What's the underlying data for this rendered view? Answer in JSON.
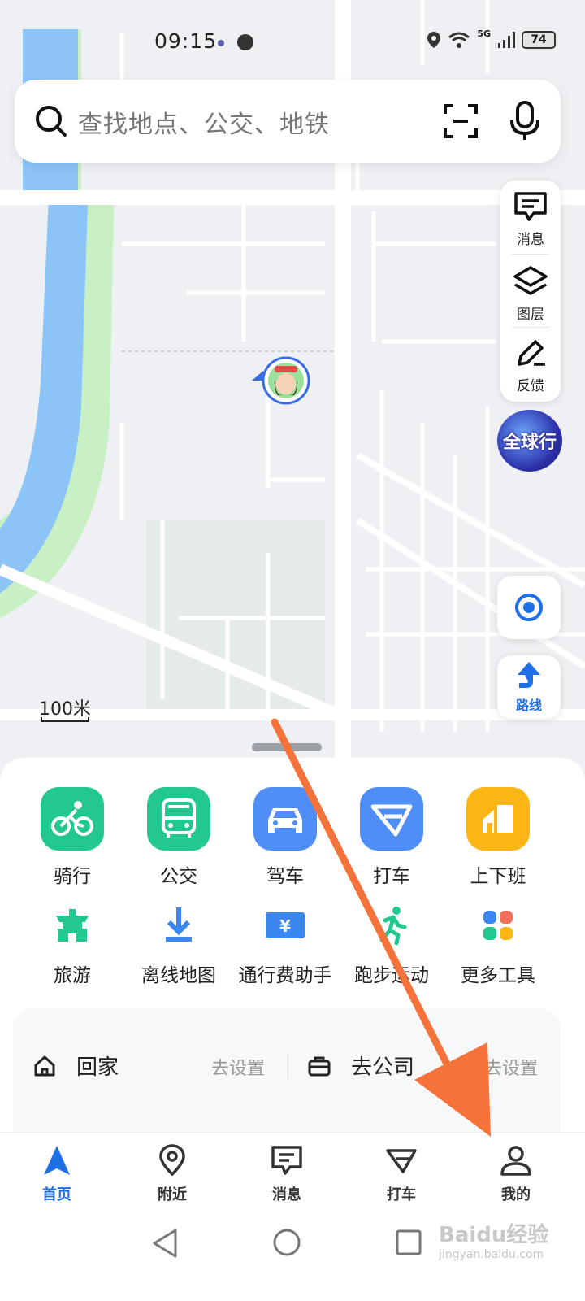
{
  "status_bar": {
    "time": "09:15",
    "network": "5G",
    "battery": "74"
  },
  "search": {
    "placeholder": "查找地点、公交、地铁"
  },
  "map_tools": {
    "messages": "消息",
    "layers": "图层",
    "feedback": "反馈"
  },
  "badge": {
    "label": "全球行"
  },
  "route_button": {
    "label": "路线"
  },
  "scale": {
    "label": "100米"
  },
  "services_row1": [
    {
      "label": "骑行",
      "icon": "bike-icon",
      "color": "#22c88f"
    },
    {
      "label": "公交",
      "icon": "bus-icon",
      "color": "#22c88f"
    },
    {
      "label": "驾车",
      "icon": "car-icon",
      "color": "#4f8ef7"
    },
    {
      "label": "打车",
      "icon": "taxi-icon",
      "color": "#4f8ef7"
    },
    {
      "label": "上下班",
      "icon": "commute-icon",
      "color": "#fbb616"
    }
  ],
  "services_row2": [
    {
      "label": "旅游",
      "icon": "travel-icon"
    },
    {
      "label": "离线地图",
      "icon": "download-icon"
    },
    {
      "label": "通行费助手",
      "icon": "toll-icon"
    },
    {
      "label": "跑步运动",
      "icon": "running-icon"
    },
    {
      "label": "更多工具",
      "icon": "more-tools-icon"
    }
  ],
  "quick_routes": {
    "home": "回家",
    "home_action": "去设置",
    "work": "去公司",
    "work_action": "去设置"
  },
  "tabs": [
    {
      "label": "首页",
      "active": true
    },
    {
      "label": "附近"
    },
    {
      "label": "消息"
    },
    {
      "label": "打车"
    },
    {
      "label": "我的"
    }
  ],
  "watermark": {
    "text": "Baidu经验",
    "sub": "jingyan.baidu.com"
  },
  "colors": {
    "accent": "#1e6fe6",
    "annotation_arrow": "#f5733a"
  }
}
